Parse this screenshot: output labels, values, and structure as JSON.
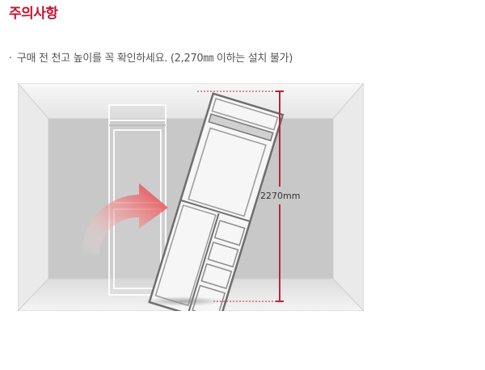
{
  "header": {
    "title": "주의사항"
  },
  "notice": {
    "bullet": "·",
    "text": "구매 전 천고 높이를 꼭 확인하세요. (2,270㎜ 이하는 설치 불가)"
  },
  "illustration": {
    "height_label": "2270mm",
    "colors": {
      "title_red": "#c4122f",
      "dimension_line": "#b5283a",
      "arrow_gradient_start": "#e9373d",
      "wall_gray": "#c8c8c8",
      "side_wall": "#e5e5e5"
    }
  }
}
